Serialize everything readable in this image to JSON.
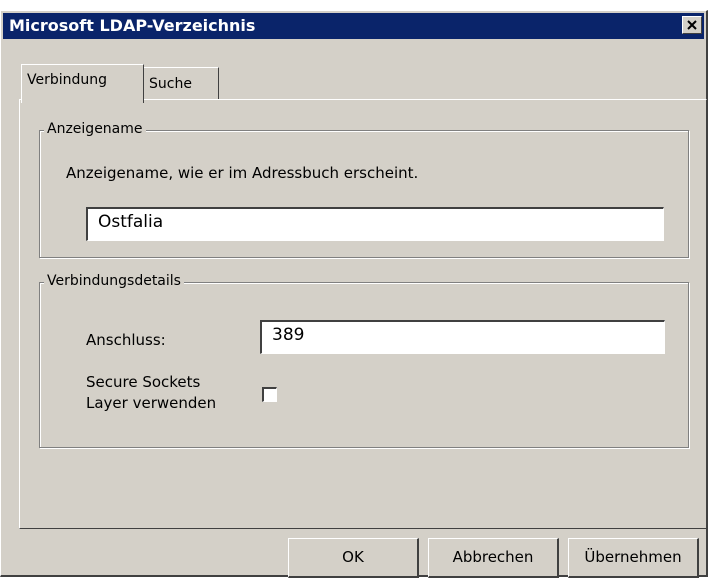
{
  "window": {
    "title": "Microsoft LDAP-Verzeichnis"
  },
  "tabs": [
    {
      "label": "Verbindung",
      "active": true
    },
    {
      "label": "Suche",
      "active": false
    }
  ],
  "display_name_group": {
    "label": "Anzeigename",
    "description": "Anzeigename, wie er im Adressbuch erscheint.",
    "value": "Ostfalia"
  },
  "connection_group": {
    "label": "Verbindungsdetails",
    "port_label": "Anschluss:",
    "port_value": "389",
    "ssl_label_line1": "Secure Sockets",
    "ssl_label_line2": "Layer verwenden",
    "ssl_checked": false
  },
  "buttons": {
    "ok": "OK",
    "cancel": "Abbrechen",
    "apply": "Übernehmen"
  },
  "colors": {
    "title_bar": "#0a246a",
    "face": "#d4d0c8"
  }
}
